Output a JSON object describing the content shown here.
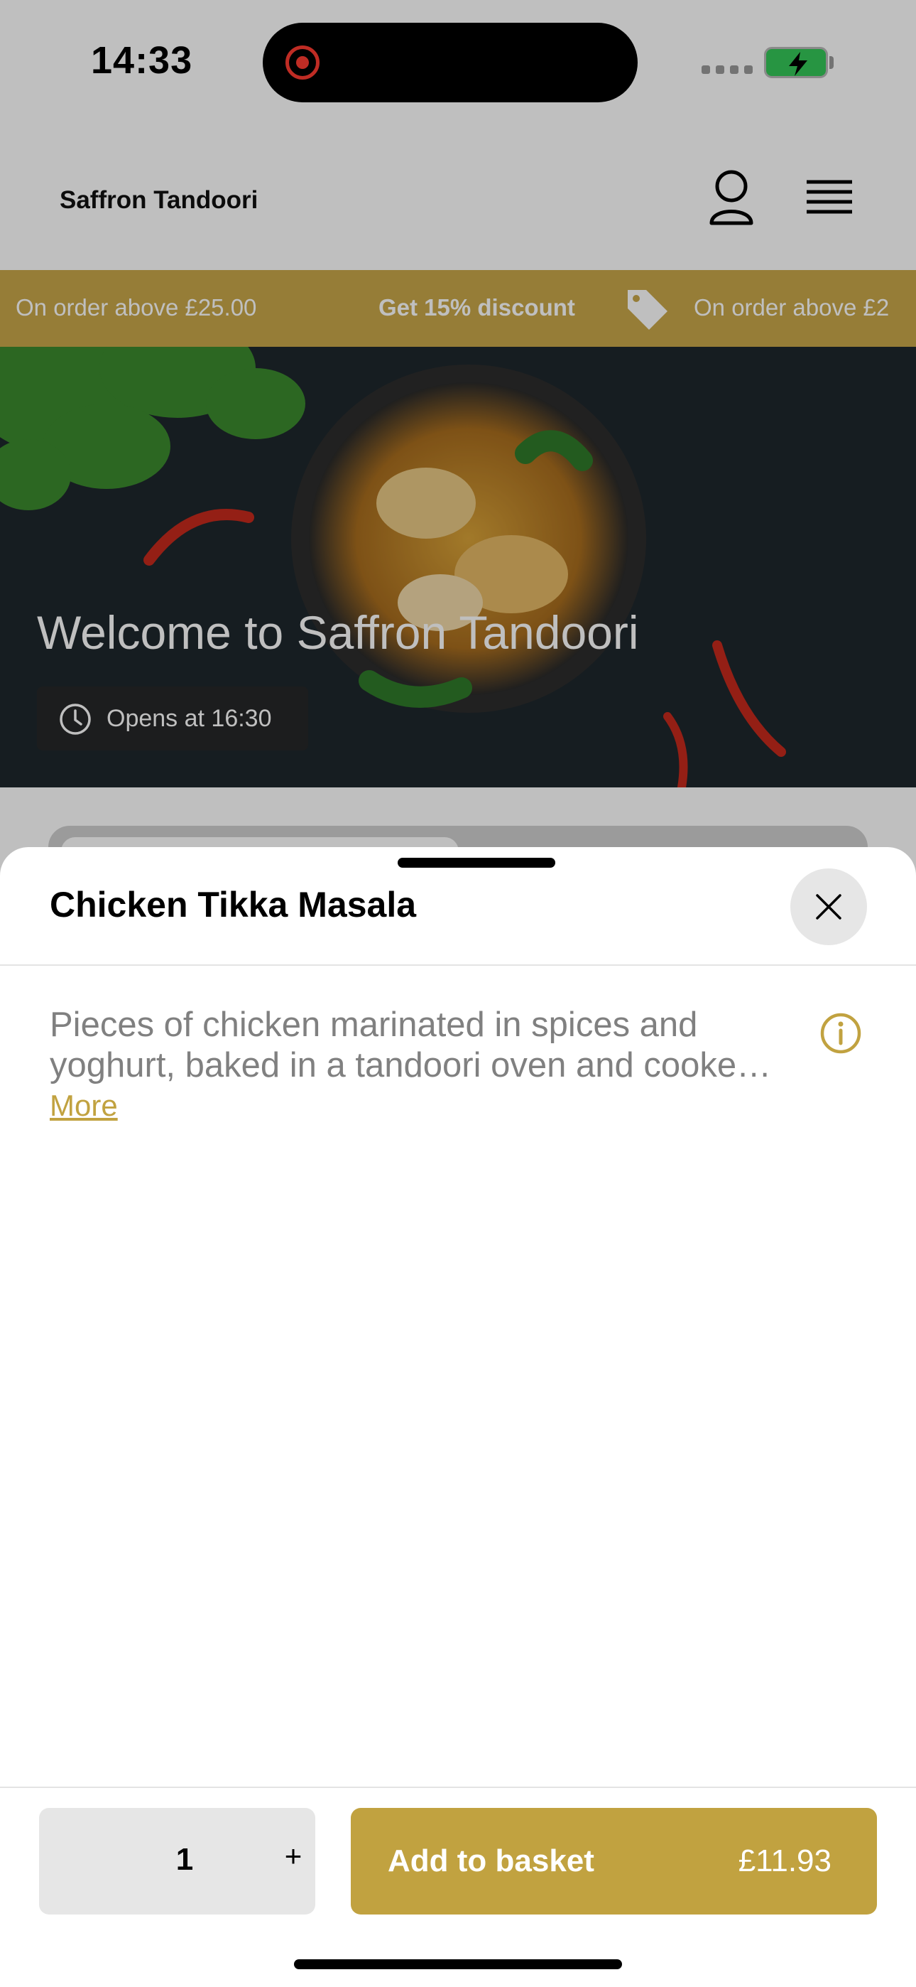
{
  "status_bar": {
    "time": "14:33"
  },
  "header": {
    "brand": "Saffron Tandoori"
  },
  "promo": {
    "left_text": "On order above £25.00",
    "center_text": "Get 15% discount",
    "right_text": "On order above £2",
    "color": "#c8a74a"
  },
  "hero": {
    "title": "Welcome to Saffron Tandoori",
    "badge": "Opens at 16:30"
  },
  "sheet": {
    "title": "Chicken Tikka Masala",
    "description_line1": "Pieces of chicken marinated in spices and",
    "description_line2": "yoghurt, baked in a tandoori oven and cooke…",
    "more_label": "More",
    "quantity": "1",
    "plus_label": "+",
    "add_label": "Add to basket",
    "price": "£11.93",
    "accent": "#c1a240"
  },
  "icons": [
    "record-icon",
    "battery-icon",
    "user-icon",
    "menu-icon",
    "tag-icon",
    "clock-icon",
    "close-icon",
    "info-icon"
  ]
}
